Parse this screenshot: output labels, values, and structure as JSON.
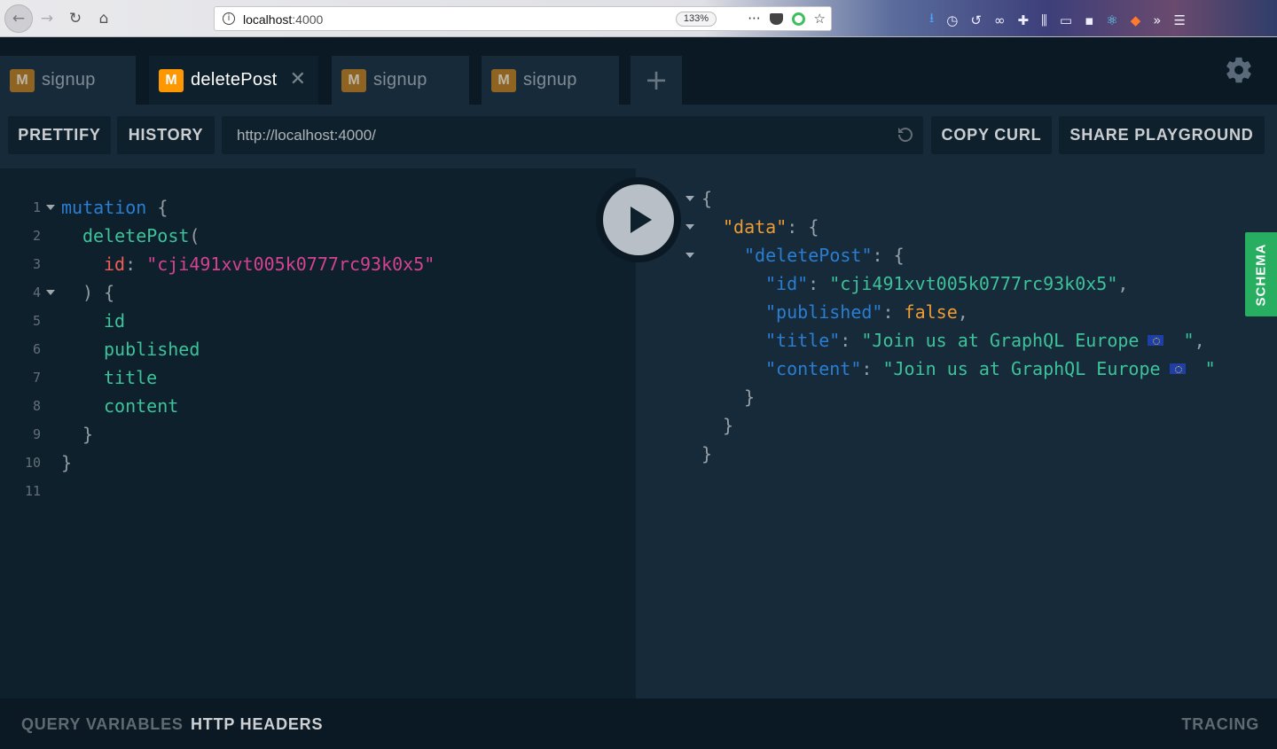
{
  "browser": {
    "url_host": "localhost",
    "url_port": ":4000",
    "zoom": "133%",
    "page_actions_icon": "···",
    "star_icon": "☆",
    "menu_icon": "☰"
  },
  "tabs": [
    {
      "badge": "M",
      "label": "signup",
      "active": false
    },
    {
      "badge": "M",
      "label": "deletePost",
      "active": true
    },
    {
      "badge": "M",
      "label": "signup",
      "active": false
    },
    {
      "badge": "M",
      "label": "signup",
      "active": false
    }
  ],
  "add_tab_label": "+",
  "toolbar": {
    "prettify": "PRETTIFY",
    "history": "HISTORY",
    "endpoint": "http://localhost:4000/",
    "copy_curl": "COPY CURL",
    "share": "SHARE PLAYGROUND"
  },
  "editor": {
    "line_numbers": [
      "1",
      "2",
      "3",
      "4",
      "5",
      "6",
      "7",
      "8",
      "9",
      "10",
      "11"
    ],
    "tokens": {
      "mutation": "mutation",
      "open_brace": " {",
      "deletePost": "deletePost",
      "open_paren": "(",
      "arg_name": "id",
      "colon": ": ",
      "arg_value": "\"cji491xvt005k0777rc93k0x5\"",
      "close_paren_brace": ") {",
      "fields": [
        "id",
        "published",
        "title",
        "content"
      ],
      "close_brace": "}"
    }
  },
  "result": {
    "open": "{",
    "data_key": "\"data\"",
    "deletePost_key": "\"deletePost\"",
    "id_key": "\"id\"",
    "id_value": "\"cji491xvt005k0777rc93k0x5\"",
    "published_key": "\"published\"",
    "published_value": "false",
    "title_key": "\"title\"",
    "title_value_start": "\"Join us at GraphQL Europe",
    "title_value_end": " \"",
    "content_key": "\"content\"",
    "content_value_start": "\"Join us at GraphQL Europe",
    "content_value_end": " \"",
    "colon": ": ",
    "brace_open": "{",
    "brace_close": "}",
    "comma": ","
  },
  "schema_tab": "SCHEMA",
  "bottom": {
    "query_variables": "QUERY VARIABLES",
    "http_headers": "HTTP HEADERS",
    "tracing": "TRACING"
  }
}
